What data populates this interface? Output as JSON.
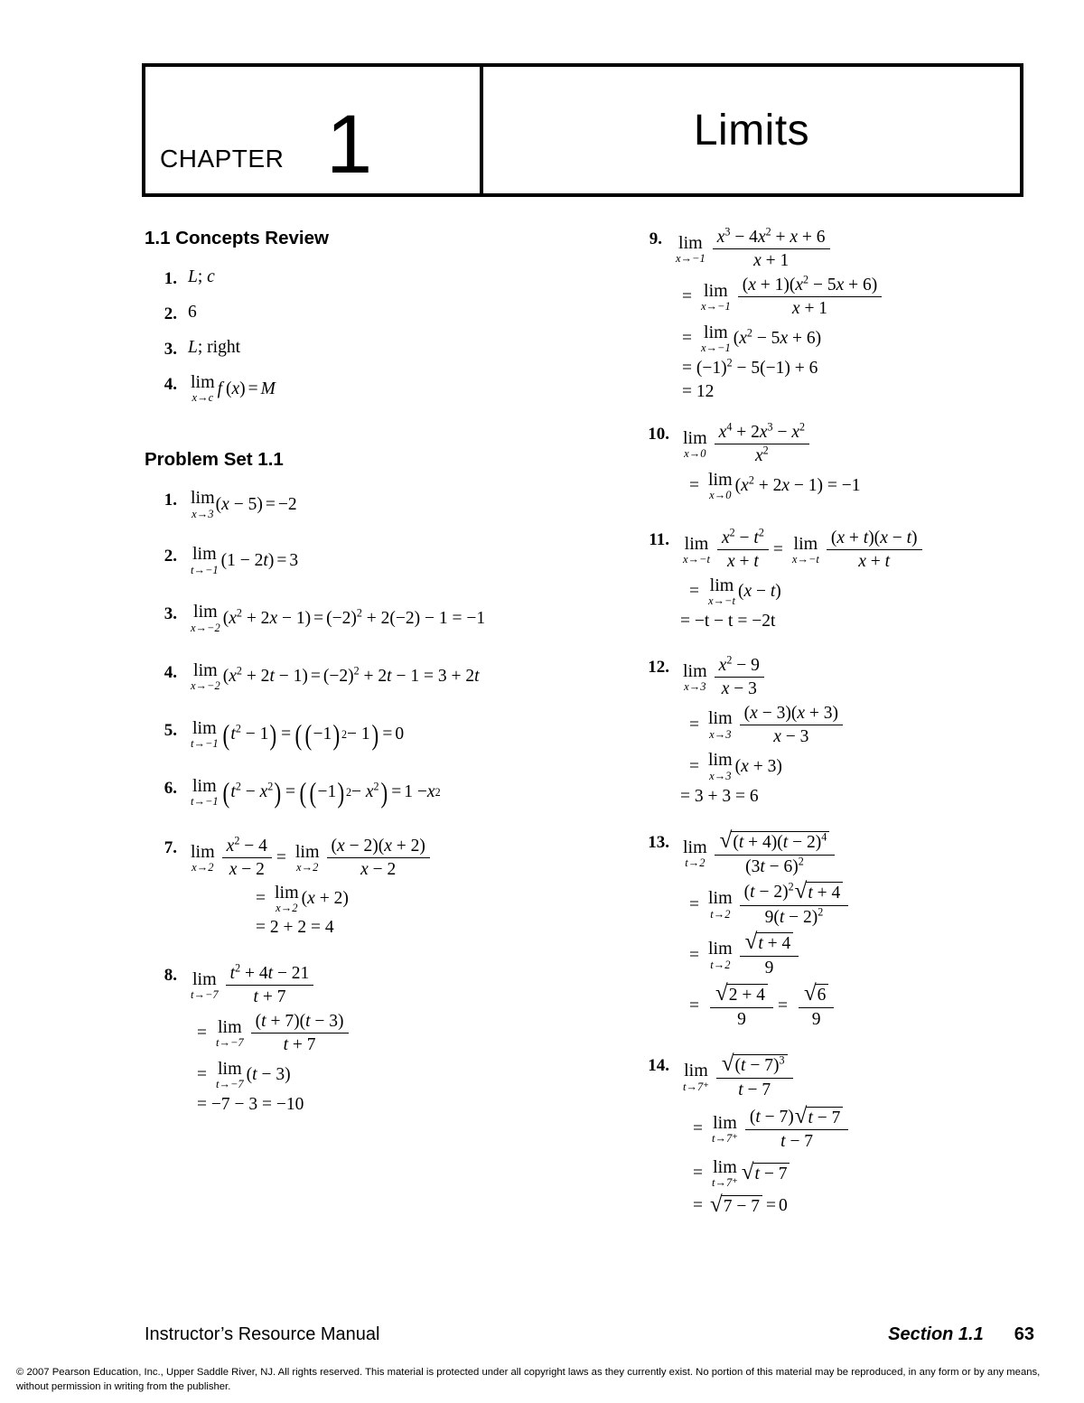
{
  "header": {
    "chapter_word": "CHAPTER",
    "chapter_number": "1",
    "chapter_title": "Limits"
  },
  "sections": {
    "concepts_review_title": "1.1 Concepts Review",
    "problem_set_title": "Problem Set 1.1"
  },
  "concepts_review": [
    {
      "n": "1.",
      "answer": "L; c"
    },
    {
      "n": "2.",
      "answer": "6"
    },
    {
      "n": "3.",
      "answer": "L; right"
    },
    {
      "n": "4.",
      "answer": "lim f(x) = M",
      "sub": "x→c"
    }
  ],
  "problems": {
    "p1": {
      "n": "1.",
      "sub": "x→3",
      "expr": "(x − 5) = −2"
    },
    "p2": {
      "n": "2.",
      "sub": "t→−1",
      "expr": "(1 − 2t) = 3"
    },
    "p3": {
      "n": "3.",
      "sub": "x→−2",
      "expr": "(x² + 2x − 1) = (−2)² + 2(−2) − 1 = −1"
    },
    "p4": {
      "n": "4.",
      "sub": "x→−2",
      "expr": "(x² + 2t − 1) = (−2)² + 2t − 1 = 3 + 2t"
    },
    "p5": {
      "n": "5.",
      "sub": "t→−1",
      "expr": "(t² − 1) = ((−1)² − 1) = 0"
    },
    "p6": {
      "n": "6.",
      "sub": "t→−1",
      "expr": "(t² − x²) = ((−1)² − x²) = 1 − x²"
    },
    "p7": {
      "n": "7.",
      "sub": "x→2",
      "line1_num": "x² − 4",
      "line1_den": "x − 2",
      "line2_num": "(x − 2)(x + 2)",
      "line2_den": "x − 2",
      "line3": "(x + 2)",
      "line4": "= 2 + 2 = 4"
    },
    "p8": {
      "n": "8.",
      "sub": "t→−7",
      "line1_num": "t² + 4t − 21",
      "line1_den": "t + 7",
      "line2_num": "(t + 7)(t − 3)",
      "line2_den": "t + 7",
      "line3": "(t − 3)",
      "line4": "= −7 − 3 = −10"
    },
    "p9": {
      "n": "9.",
      "sub": "x→−1",
      "line1_num": "x³ − 4x² + x + 6",
      "line1_den": "x + 1",
      "line2_num": "(x + 1)(x² − 5x + 6)",
      "line2_den": "x + 1",
      "line3": "(x² − 5x + 6)",
      "line4": "= (−1)² − 5(−1) + 6",
      "line5": "= 12"
    },
    "p10": {
      "n": "10.",
      "sub": "x→0",
      "line1_num": "x⁴ + 2x³ − x²",
      "line1_den": "x²",
      "line2": "(x² + 2x − 1) = −1"
    },
    "p11": {
      "n": "11.",
      "sub": "x→−t",
      "line1_num": "x² − t²",
      "line1_den": "x + t",
      "line1b_num": "(x + t)(x − t)",
      "line1b_den": "x + t",
      "line2": "(x − t)",
      "line3": "= −t − t = −2t"
    },
    "p12": {
      "n": "12.",
      "sub": "x→3",
      "line1_num": "x² − 9",
      "line1_den": "x − 3",
      "line2_num": "(x − 3)(x + 3)",
      "line2_den": "x − 3",
      "line3": "(x + 3)",
      "line4": "= 3 + 3 = 6"
    },
    "p13": {
      "n": "13.",
      "sub": "t→2",
      "line1_num_rad": "(t + 4)(t − 2)⁴",
      "line1_den": "(3t − 6)²",
      "line2_num": "(t − 2)² √(t + 4)",
      "line2_den": "9(t − 2)²",
      "line3_num_rad": "t + 4",
      "line3_den": "9",
      "line4_num_rad": "2 + 4",
      "line4_den": "9",
      "line4b_num_rad": "6",
      "line4b_den": "9"
    },
    "p14": {
      "n": "14.",
      "sub": "t→7⁺",
      "line1_num_rad": "(t − 7)³",
      "line1_den": "t − 7",
      "line2_num": "(t − 7)√(t − 7)",
      "line2_den": "t − 7",
      "line3": "√(t − 7)",
      "line4": "= √(7 − 7) = 0"
    }
  },
  "footer": {
    "manual": "Instructor’s Resource Manual",
    "section": "Section 1.1",
    "page": "63",
    "copyright": "© 2007 Pearson Education, Inc., Upper Saddle River, NJ.  All rights reserved. This material is protected under all copyright laws as they currently exist. No portion of this material may be reproduced, in any form or by any means, without permission in writing from the publisher."
  }
}
